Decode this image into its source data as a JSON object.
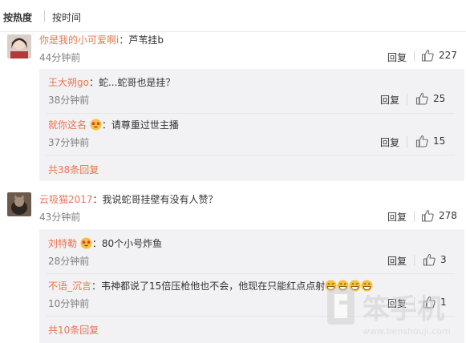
{
  "sort": {
    "hot": "按热度",
    "time": "按时间"
  },
  "comments": [
    {
      "user": "你是我的小可爱啊i",
      "text": "：芦苇挂b",
      "time": "44分钟前",
      "reply": "回复",
      "likes": "227",
      "subs": [
        {
          "user": "王大朔go",
          "text": "：蛇...蛇哥也是挂？",
          "time": "38分钟前",
          "reply": "回复",
          "likes": "25"
        },
        {
          "user": "就你这名",
          "text": "：请尊重过世主播",
          "time": "37分钟前",
          "reply": "回复",
          "likes": "15"
        }
      ],
      "more": "共38条回复"
    },
    {
      "user": "云吸猫2017",
      "text": "：我说蛇哥挂壁有没有人赞？",
      "time": "43分钟前",
      "reply": "回复",
      "likes": "278",
      "subs": [
        {
          "user": "刘特勒",
          "text": "：80个小号炸鱼",
          "time": "28分钟前",
          "reply": "回复",
          "likes": "3"
        },
        {
          "user": "不语_沉言",
          "text": "：韦神都说了15倍压枪他也不会，他现在只能红点点射",
          "time": "10分钟前",
          "reply": "回复",
          "likes": "1"
        }
      ],
      "more": "共10条回复"
    }
  ],
  "colors": {
    "username": "#eb7350",
    "time": "#808080",
    "subbox": "#f2f2f5"
  }
}
